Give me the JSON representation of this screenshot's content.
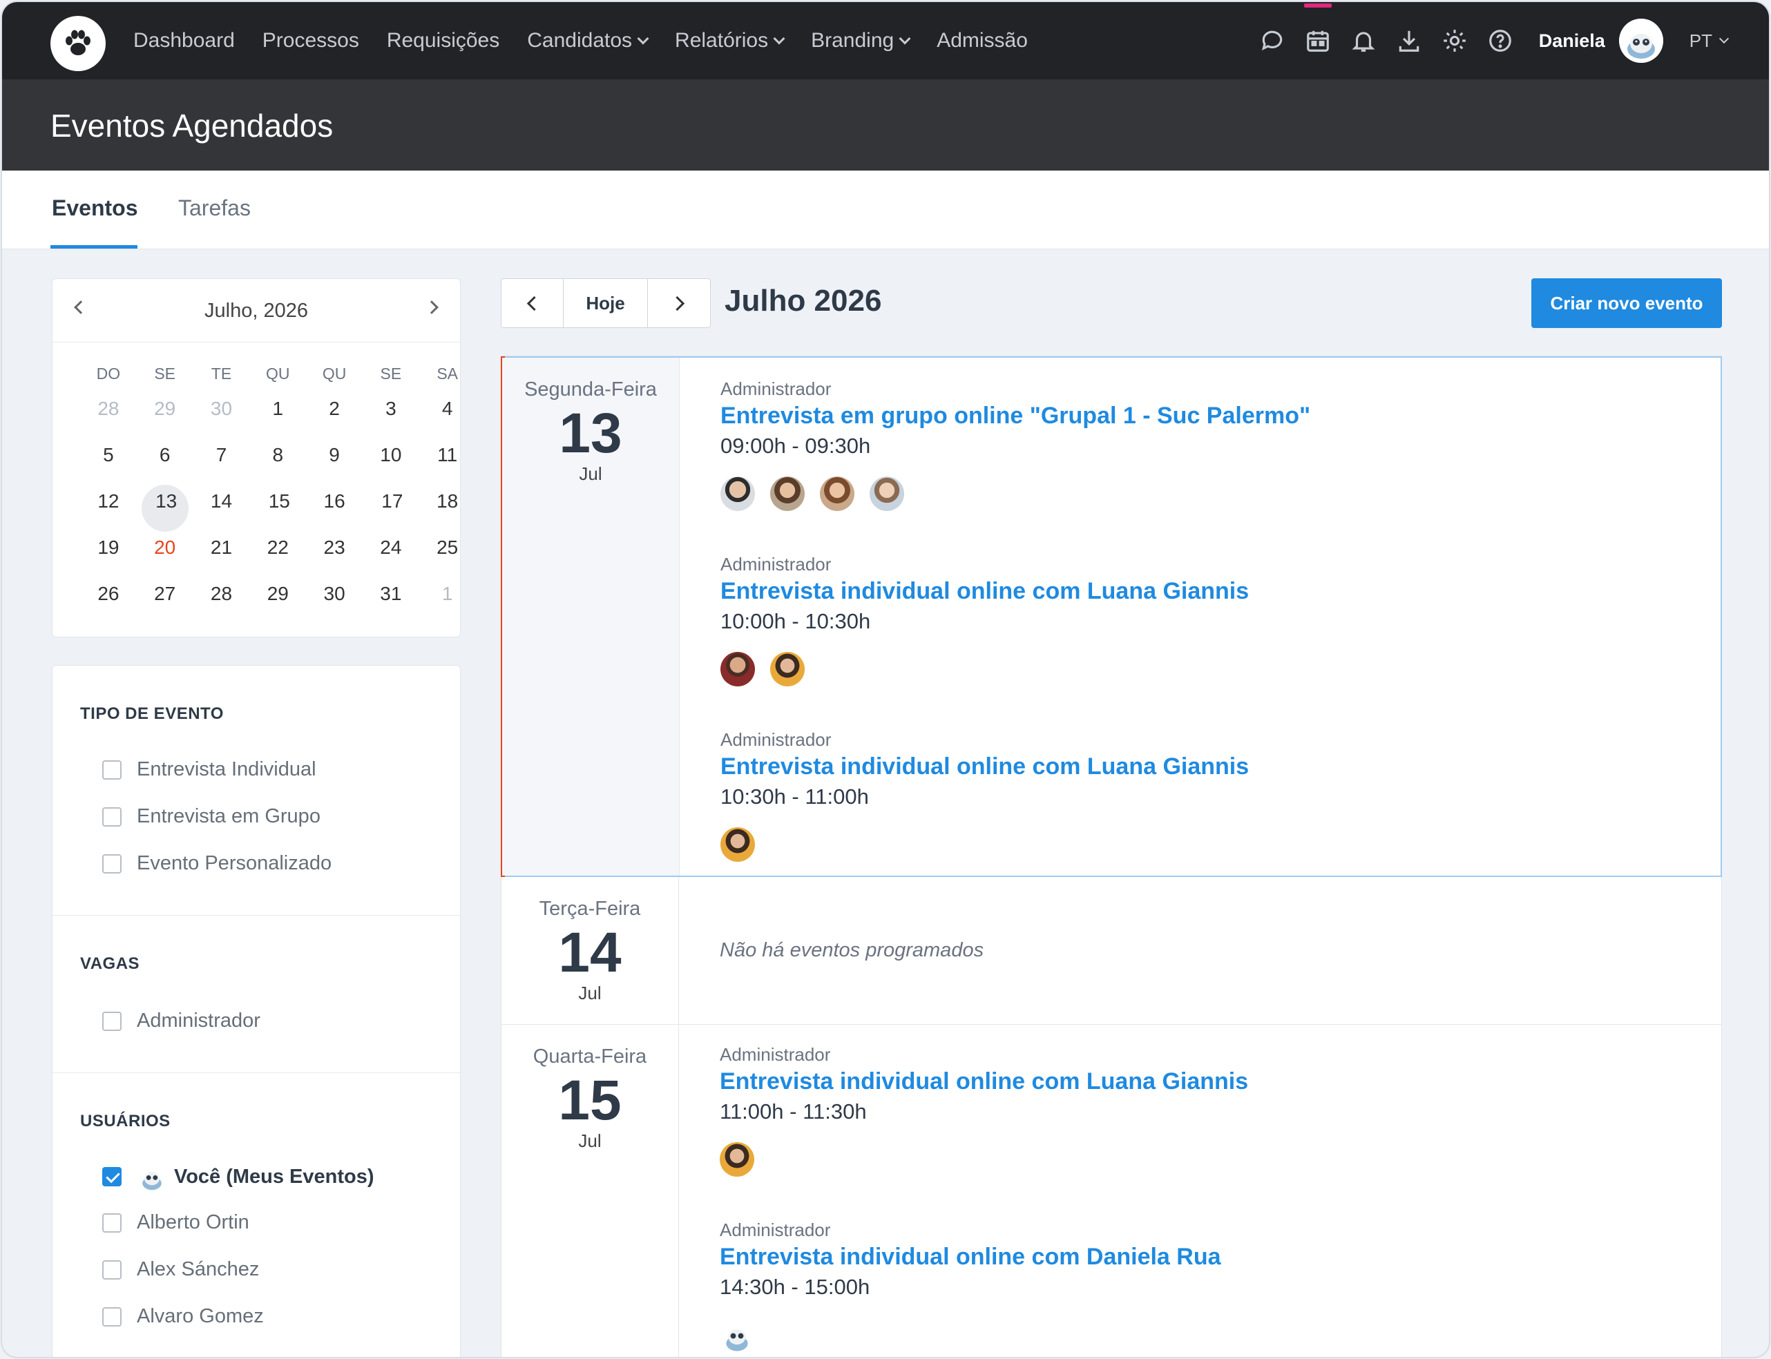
{
  "nav": {
    "links": [
      {
        "label": "Dashboard",
        "dropdown": false
      },
      {
        "label": "Processos",
        "dropdown": false
      },
      {
        "label": "Requisições",
        "dropdown": false
      },
      {
        "label": "Candidatos",
        "dropdown": true
      },
      {
        "label": "Relatórios",
        "dropdown": true
      },
      {
        "label": "Branding",
        "dropdown": true
      },
      {
        "label": "Admissão",
        "dropdown": false
      }
    ],
    "icons": [
      "chat-icon",
      "calendar-icon",
      "bell-icon",
      "download-icon",
      "gear-icon",
      "help-icon"
    ],
    "user_name": "Daniela",
    "language": "PT"
  },
  "page_title": "Eventos Agendados",
  "tabs": [
    {
      "label": "Eventos",
      "active": true
    },
    {
      "label": "Tarefas",
      "active": false
    }
  ],
  "mini_calendar": {
    "title": "Julho, 2026",
    "weekdays": [
      "DO",
      "SE",
      "TE",
      "QU",
      "QU",
      "SE",
      "SA"
    ],
    "weeks": [
      [
        {
          "d": "28",
          "m": true
        },
        {
          "d": "29",
          "m": true
        },
        {
          "d": "30",
          "m": true
        },
        {
          "d": "1"
        },
        {
          "d": "2"
        },
        {
          "d": "3"
        },
        {
          "d": "4"
        }
      ],
      [
        {
          "d": "5"
        },
        {
          "d": "6"
        },
        {
          "d": "7"
        },
        {
          "d": "8"
        },
        {
          "d": "9"
        },
        {
          "d": "10"
        },
        {
          "d": "11"
        }
      ],
      [
        {
          "d": "12"
        },
        {
          "d": "13",
          "sel": true,
          "dot": true
        },
        {
          "d": "14"
        },
        {
          "d": "15",
          "dot": true
        },
        {
          "d": "16"
        },
        {
          "d": "17",
          "dot": true
        },
        {
          "d": "18"
        }
      ],
      [
        {
          "d": "19"
        },
        {
          "d": "20",
          "red": true
        },
        {
          "d": "21"
        },
        {
          "d": "22"
        },
        {
          "d": "23"
        },
        {
          "d": "24"
        },
        {
          "d": "25"
        }
      ],
      [
        {
          "d": "26"
        },
        {
          "d": "27"
        },
        {
          "d": "28"
        },
        {
          "d": "29"
        },
        {
          "d": "30"
        },
        {
          "d": "31"
        },
        {
          "d": "1",
          "m": true
        }
      ]
    ]
  },
  "filters": {
    "event_type": {
      "heading": "TIPO DE EVENTO",
      "options": [
        "Entrevista Individual",
        "Entrevista em Grupo",
        "Evento Personalizado"
      ]
    },
    "jobs": {
      "heading": "VAGAS",
      "options": [
        "Administrador"
      ]
    },
    "users": {
      "heading": "USUÁRIOS",
      "me": "Você (Meus Eventos)",
      "options": [
        "Alberto Ortin",
        "Alex Sánchez",
        "Alvaro Gomez"
      ]
    }
  },
  "toolbar": {
    "today_label": "Hoje",
    "month_title": "Julho 2026",
    "create_label": "Criar novo evento"
  },
  "days": [
    {
      "weekday": "Segunda-Feira",
      "day": "13",
      "month": "Jul",
      "events": [
        {
          "owner": "Administrador",
          "title": "Entrevista em grupo online \"Grupal 1 - Suc Palermo\"",
          "time": "09:00h - 09:30h",
          "avatars": 4
        },
        {
          "owner": "Administrador",
          "title": "Entrevista individual online com Luana Giannis",
          "time": "10:00h - 10:30h",
          "avatars": 2
        },
        {
          "owner": "Administrador",
          "title": "Entrevista individual online com Luana Giannis",
          "time": "10:30h - 11:00h",
          "avatars": 1
        }
      ]
    },
    {
      "weekday": "Terça-Feira",
      "day": "14",
      "month": "Jul",
      "no_events": "Não há eventos programados"
    },
    {
      "weekday": "Quarta-Feira",
      "day": "15",
      "month": "Jul",
      "events": [
        {
          "owner": "Administrador",
          "title": "Entrevista individual online com Luana Giannis",
          "time": "11:00h - 11:30h",
          "avatars": 1
        },
        {
          "owner": "Administrador",
          "title": "Entrevista individual online com Daniela Rua",
          "time": "14:30h - 15:00h",
          "avatars": 1
        }
      ]
    }
  ],
  "colors": {
    "accent": "#1f8ae0",
    "today_marker": "#e8441b",
    "nav_bg": "#212327"
  }
}
